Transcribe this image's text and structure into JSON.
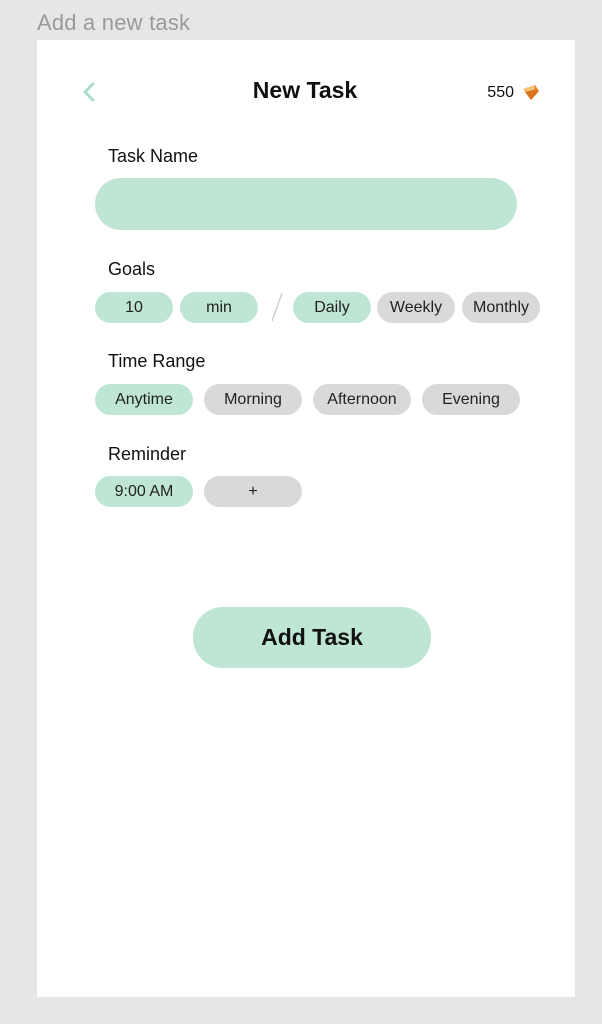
{
  "frame_label": "Add a new task",
  "header": {
    "title": "New Task",
    "coins": "550",
    "coin_icon": "gem-icon",
    "back_icon": "chevron-left-icon"
  },
  "task_name": {
    "label": "Task Name",
    "value": "",
    "placeholder": ""
  },
  "goals": {
    "label": "Goals",
    "amount": "10",
    "unit": "min",
    "periods": [
      {
        "label": "Daily",
        "selected": true
      },
      {
        "label": "Weekly",
        "selected": false
      },
      {
        "label": "Monthly",
        "selected": false
      }
    ]
  },
  "time_range": {
    "label": "Time Range",
    "options": [
      {
        "label": "Anytime",
        "selected": true
      },
      {
        "label": "Morning",
        "selected": false
      },
      {
        "label": "Afternoon",
        "selected": false
      },
      {
        "label": "Evening",
        "selected": false
      }
    ]
  },
  "reminder": {
    "label": "Reminder",
    "time": "9:00 AM",
    "add_label": "+"
  },
  "submit": {
    "label": "Add Task"
  },
  "colors": {
    "accent": "#bfe5d4",
    "chip_inactive": "#d9d9d9",
    "background": "#e6e6e6",
    "card": "#ffffff",
    "back_icon": "#a9dcc6",
    "gem_orange": "#e8892b"
  }
}
